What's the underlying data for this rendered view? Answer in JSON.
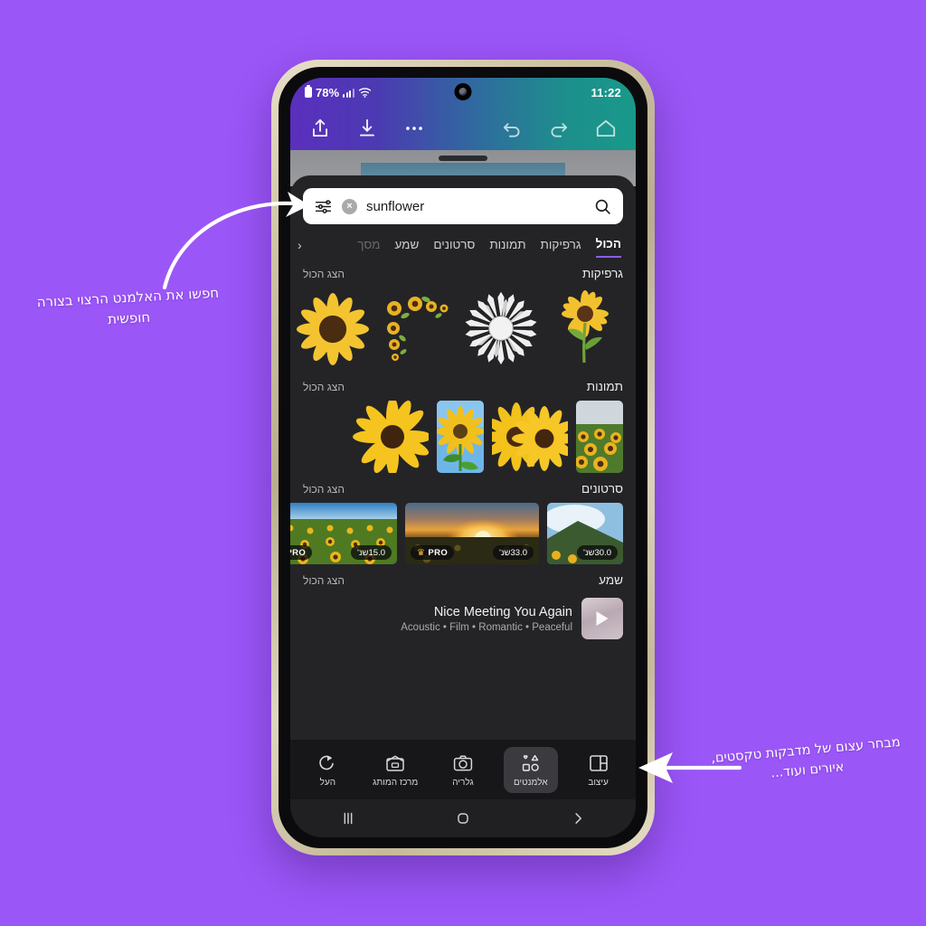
{
  "status_bar": {
    "battery": "78%",
    "time": "11:22",
    "signal_icon": "signal-bars-icon",
    "wifi_icon": "wifi-icon",
    "battery_icon": "battery-icon",
    "camera_icon": "front-camera-punchhole"
  },
  "toolbar": {
    "share_icon": "share-icon",
    "download_icon": "download-icon",
    "more_icon": "more-options-icon",
    "undo_icon": "undo-icon",
    "redo_icon": "redo-icon",
    "home_icon": "home-icon"
  },
  "search": {
    "value": "sunflower",
    "placeholder": "sunflower",
    "filter_icon": "filter-sliders-icon",
    "clear_icon": "clear-x-icon",
    "clear_glyph": "×",
    "search_icon": "search-icon"
  },
  "tabs": {
    "chevron": "‹",
    "items": [
      {
        "label": "הכול",
        "active": true,
        "faded": false
      },
      {
        "label": "גרפיקות",
        "active": false,
        "faded": false
      },
      {
        "label": "תמונות",
        "active": false,
        "faded": false
      },
      {
        "label": "סרטונים",
        "active": false,
        "faded": false
      },
      {
        "label": "שמע",
        "active": false,
        "faded": false
      },
      {
        "label": "מסך",
        "active": false,
        "faded": true
      }
    ]
  },
  "sections": {
    "show_all_label": "הצג הכול",
    "graphics": {
      "title": "גרפיקות",
      "items": [
        {
          "name": "sunflower-with-stem-graphic"
        },
        {
          "name": "sunflower-line-art-graphic"
        },
        {
          "name": "sunflower-corner-border-graphic"
        },
        {
          "name": "sunflower-flat-illustration-graphic"
        }
      ]
    },
    "images": {
      "title": "תמונות",
      "items": [
        {
          "name": "sunflower-field-photo"
        },
        {
          "name": "two-sunflowers-photo"
        },
        {
          "name": "sunflower-blue-sky-photo"
        },
        {
          "name": "single-sunflower-closeup-photo"
        }
      ]
    },
    "videos": {
      "title": "סרטונים",
      "items": [
        {
          "name": "sunflower-sky-video",
          "duration": "30.0שנ'",
          "pro": false
        },
        {
          "name": "sunset-sunflower-field-video",
          "duration": "33.0שנ'",
          "pro": true
        },
        {
          "name": "sunflower-field-daylight-video",
          "duration": "15.0שנ'",
          "pro": true
        }
      ],
      "pro_label": "PRO",
      "crown_glyph": "♛"
    },
    "audio": {
      "title": "שמע",
      "track_title": "Nice Meeting You Again",
      "track_tags": "Acoustic • Film • Romantic • Peaceful",
      "play_icon": "play-icon"
    }
  },
  "bottom_nav": {
    "items": [
      {
        "label": "העל",
        "icon": "upload-arrow-icon",
        "selected": false
      },
      {
        "label": "מרכז המותג",
        "icon": "brand-center-icon",
        "selected": false
      },
      {
        "label": "גלריה",
        "icon": "camera-icon",
        "selected": false
      },
      {
        "label": "אלמנטים",
        "icon": "shapes-elements-icon",
        "selected": true
      },
      {
        "label": "עיצוב",
        "icon": "layout-grid-icon",
        "selected": false
      }
    ]
  },
  "android_nav": {
    "recents_icon": "recents-icon",
    "home_icon": "home-circle-icon",
    "back_icon": "back-chevron-icon",
    "back_glyph": "›"
  },
  "annotations": {
    "left": "חפשו את האלמנט הרצוי בצורה חופשית",
    "right": "מבחר עצום של מדבקות טקסטים, איורים ועוד..."
  },
  "colors": {
    "background": "#9b56f7",
    "accent": "#8b5cf6",
    "sheet": "#242427",
    "toolbar_start": "#5b2fbe",
    "toolbar_end": "#18998a",
    "pro_gold": "#f5b731"
  }
}
